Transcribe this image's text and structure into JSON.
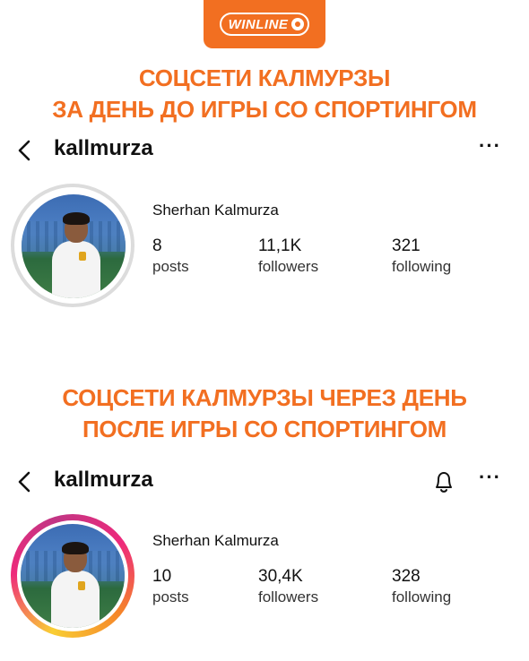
{
  "brand": {
    "name": "WINLINE",
    "color": "#f26f21"
  },
  "headline_before": {
    "line1": "СОЦСЕТИ КАЛМУРЗЫ",
    "line2": "ЗА ДЕНЬ ДО ИГРЫ СО СПОРТИНГОМ"
  },
  "profile_before": {
    "username": "kallmurza",
    "full_name": "Sherhan Kalmurza",
    "stats": [
      {
        "value": "8",
        "label": "posts"
      },
      {
        "value": "11,1K",
        "label": "followers"
      },
      {
        "value": "321",
        "label": "following"
      }
    ],
    "icons": [
      "back-icon",
      "more-icon"
    ]
  },
  "headline_after": {
    "line1": "СОЦСЕТИ КАЛМУРЗЫ ЧЕРЕЗ ДЕНЬ",
    "line2": "ПОСЛЕ ИГРЫ СО СПОРТИНГОМ"
  },
  "profile_after": {
    "username": "kallmurza",
    "full_name": "Sherhan Kalmurza",
    "stats": [
      {
        "value": "10",
        "label": "posts"
      },
      {
        "value": "30,4K",
        "label": "followers"
      },
      {
        "value": "328",
        "label": "following"
      }
    ],
    "icons": [
      "back-icon",
      "bell-icon",
      "more-icon"
    ]
  },
  "more_glyph": "···"
}
